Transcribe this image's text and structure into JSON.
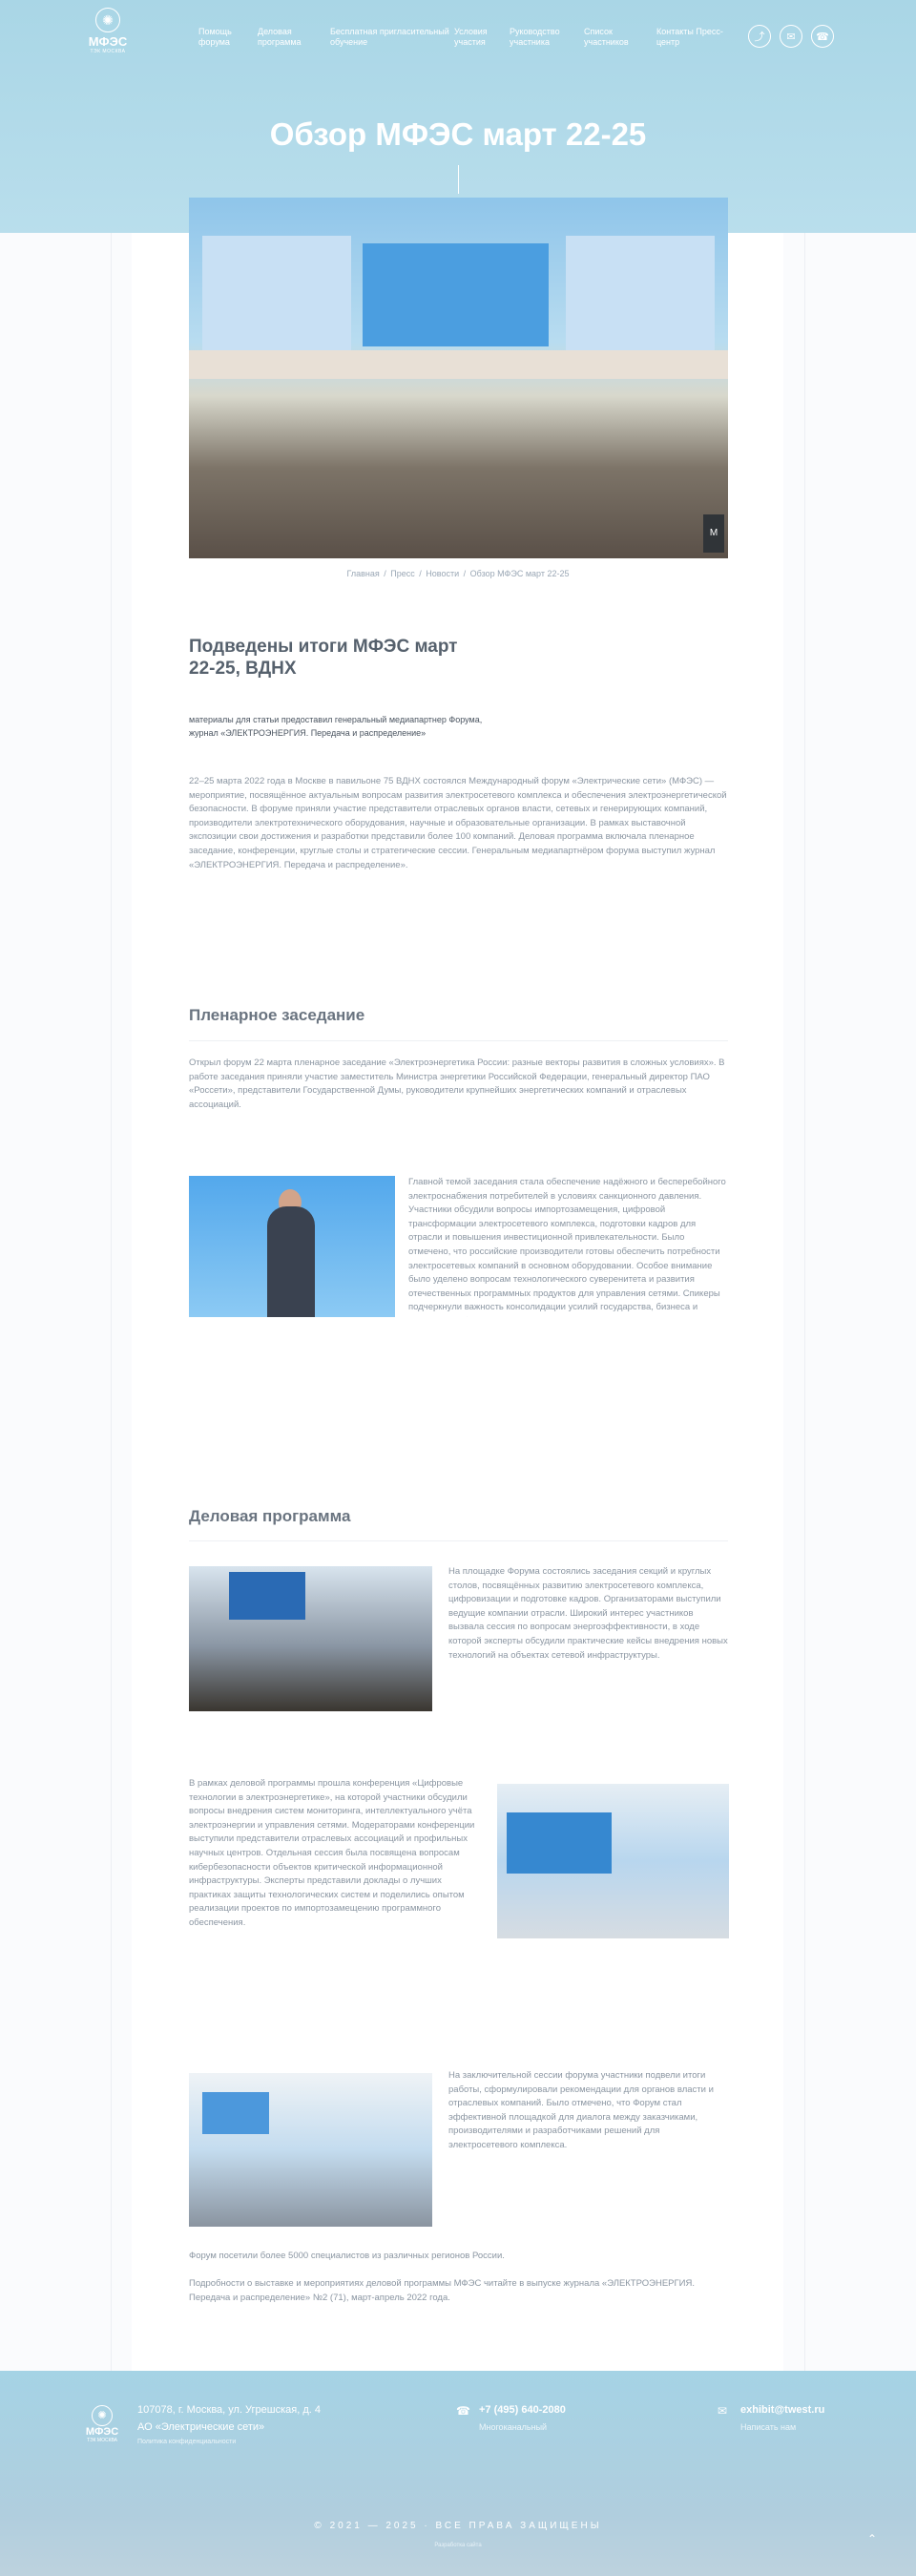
{
  "header": {
    "logo_text": "МФЭС",
    "logo_sub": "ТЭК МОСКВА",
    "nav": [
      "Помощь форума",
      "Деловая программа",
      "Бесплатная пригласительный обучение",
      "Условия участия",
      "Руководство участника",
      "Список участников",
      "Контакты Пресс-центр"
    ],
    "icons": [
      "share-icon",
      "mail-icon",
      "phone-icon"
    ]
  },
  "page": {
    "title": "Обзор МФЭС март 22-25"
  },
  "breadcrumbs": [
    "Главная",
    "Пресс",
    "Новости",
    "Обзор МФЭС март 22-25"
  ],
  "article": {
    "subtitle": "Подведены итоги МФЭС март 22-25, ВДНХ",
    "source_line1": "материалы для статьи предоставил генеральный медиапартнер Форума,",
    "source_line2": "журнал «ЭЛЕКТРОЭНЕРГИЯ. Передача и распределение»",
    "intro": "22–25 марта 2022 года в Москве в павильоне 75 ВДНХ состоялся Международный форум «Электрические сети» (МФЭС) — мероприятие, посвящённое актуальным вопросам развития электросетевого комплекса и обеспечения электроэнергетической безопасности. В форуме приняли участие представители отраслевых органов власти, сетевых и генерирующих компаний, производители электротехнического оборудования, научные и образовательные организации. В рамках выставочной экспозиции свои достижения и разработки представили более 100 компаний. Деловая программа включала пленарное заседание, конференции, круглые столы и стратегические сессии. Генеральным медиапартнёром форума выступил журнал «ЭЛЕКТРОЭНЕРГИЯ. Передача и распределение».",
    "h_plenary": "Пленарное заседание",
    "plenary_1": "Открыл форум 22 марта пленарное заседание «Электроэнергетика России: разные векторы развития в сложных условиях». В работе заседания приняли участие заместитель Министра энергетики Российской Федерации, генеральный директор ПАО «Россети», представители Государственной Думы, руководители крупнейших энергетических компаний и отраслевых ассоциаций.",
    "plenary_2": "Главной темой заседания стала обеспечение надёжного и бесперебойного электроснабжения потребителей в условиях санкционного давления. Участники обсудили вопросы импортозамещения, цифровой трансформации электросетевого комплекса, подготовки кадров для отрасли и повышения инвестиционной привлекательности. Было отмечено, что российские производители готовы обеспечить потребности электросетевых компаний в основном оборудовании. Особое внимание было уделено вопросам технологического суверенитета и развития отечественных программных продуктов для управления сетями. Спикеры подчеркнули важность консолидации усилий государства, бизнеса и научного сообщества для решения стоящих перед отраслью задач.",
    "h_business": "Деловая программа",
    "biz_1": "На площадке Форума состоялись заседания секций и круглых столов, посвящённых развитию электросетевого комплекса, цифровизации и подготовке кадров. Организаторами выступили ведущие компании отрасли. Широкий интерес участников вызвала сессия по вопросам энергоэффективности, в ходе которой эксперты обсудили практические кейсы внедрения новых технологий на объектах сетевой инфраструктуры.",
    "biz_2": "В рамках деловой программы прошла конференция «Цифровые технологии в электроэнергетике», на которой участники обсудили вопросы внедрения систем мониторинга, интеллектуального учёта электроэнергии и управления сетями. Модераторами конференции выступили представители отраслевых ассоциаций и профильных научных центров. Отдельная сессия была посвящена вопросам кибербезопасности объектов критической информационной инфраструктуры. Эксперты представили доклады о лучших практиках защиты технологических систем и поделились опытом реализации проектов по импортозамещению программного обеспечения.",
    "biz_3": "На заключительной сессии форума участники подвели итоги работы, сформулировали рекомендации для органов власти и отраслевых компаний. Было отмечено, что Форум стал эффективной площадкой для диалога между заказчиками, производителями и разработчиками решений для электросетевого комплекса.",
    "closing_1": "Форум посетили более 5000 специалистов из различных регионов России.",
    "closing_2": "Подробности о выставке и мероприятиях деловой программы МФЭС читайте в выпуске журнала «ЭЛЕКТРОЭНЕРГИЯ. Передача и распределение» №2 (71), март-апрель 2022 года."
  },
  "footer": {
    "address": "107078, г. Москва, ул. Угрешская, д. 4",
    "org": "АО «Электрические сети»",
    "policy": "Политика конфиденциальности",
    "phone": "+7 (495) 640-2080",
    "phone_note": "Многоканальный",
    "email": "exhibit@twest.ru",
    "email_note": "Написать нам",
    "copyright": "© 2021 — 2025 · ВСЕ ПРАВА ЗАЩИЩЕНЫ",
    "developer": "Разработка сайта"
  }
}
